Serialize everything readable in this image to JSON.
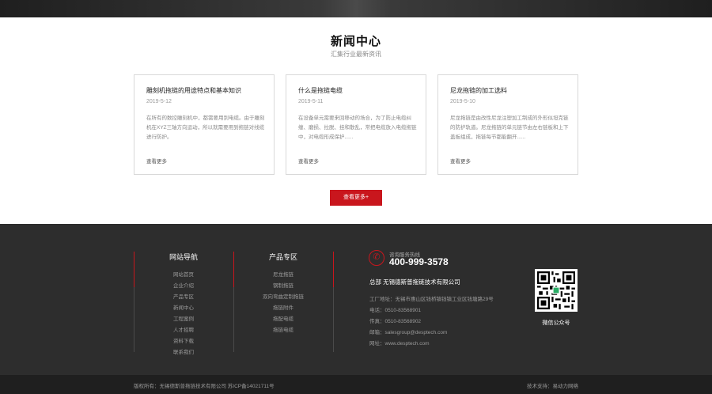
{
  "news": {
    "title": "新闻中心",
    "subtitle": "汇集行业最新资讯",
    "cards": [
      {
        "title": "雕刻机拖链的用途特点和基本知识",
        "date": "2019-5-12",
        "body": "在所有的数控雕刻机中，都需要用到电缆。由于雕刻机在XYZ三轴方向运动，所以就需要用到拖链对线缆进行防护。",
        "more": "查看更多"
      },
      {
        "title": "什么是拖链电缆",
        "date": "2019-5-11",
        "body": "在设备单元需要来回移动的场合，为了防止电缆纠缠、磨损、拉脱、挂和散乱，常把电缆放入电缆拖链中，对电缆形成保护......",
        "more": "查看更多"
      },
      {
        "title": "尼龙拖链的加工选料",
        "date": "2019-5-10",
        "body": "尼龙拖链是由改性尼龙注塑加工制成的外形似坦克链的防护轨道。尼龙拖链的单元链节由左右链板和上下盖板组成，拖链每节都能翻开......",
        "more": "查看更多"
      }
    ],
    "more_button": "查看更多+"
  },
  "footer": {
    "nav": {
      "title": "网站导航",
      "items": [
        "网站首页",
        "企业介绍",
        "产品专区",
        "新闻中心",
        "工程案例",
        "人才招聘",
        "资料下载",
        "联系我们"
      ]
    },
    "products": {
      "title": "产品专区",
      "items": [
        "尼龙拖链",
        "钢制拖链",
        "双向弯曲定制拖链",
        "拖链附件",
        "拖配电缆",
        "拖链电缆"
      ]
    },
    "contact": {
      "hotline_label": "咨询服务热线",
      "hotline": "400-999-3578",
      "company": "总部 无锡德斯普拖链技术有限公司",
      "address": "工厂地址：无锡市惠山区钱桥镇钱镇工业区钱塘路29号",
      "phone": "电话：0510-83568901",
      "fax": "传真：0510-83568902",
      "email": "邮箱：salesgroup@desptech.com",
      "website": "网址：www.desptech.com"
    },
    "qr_label": "微信公众号"
  },
  "bottom": {
    "copyright": "版权所有：无锡德斯普拖链技术有限公司    苏ICP备14021711号",
    "tech_support": "技术支持：易动力网络"
  },
  "colors": {
    "accent": "#c9161d",
    "footer_bg": "#2d2d2d",
    "bottom_bg": "#1f1f1f"
  }
}
